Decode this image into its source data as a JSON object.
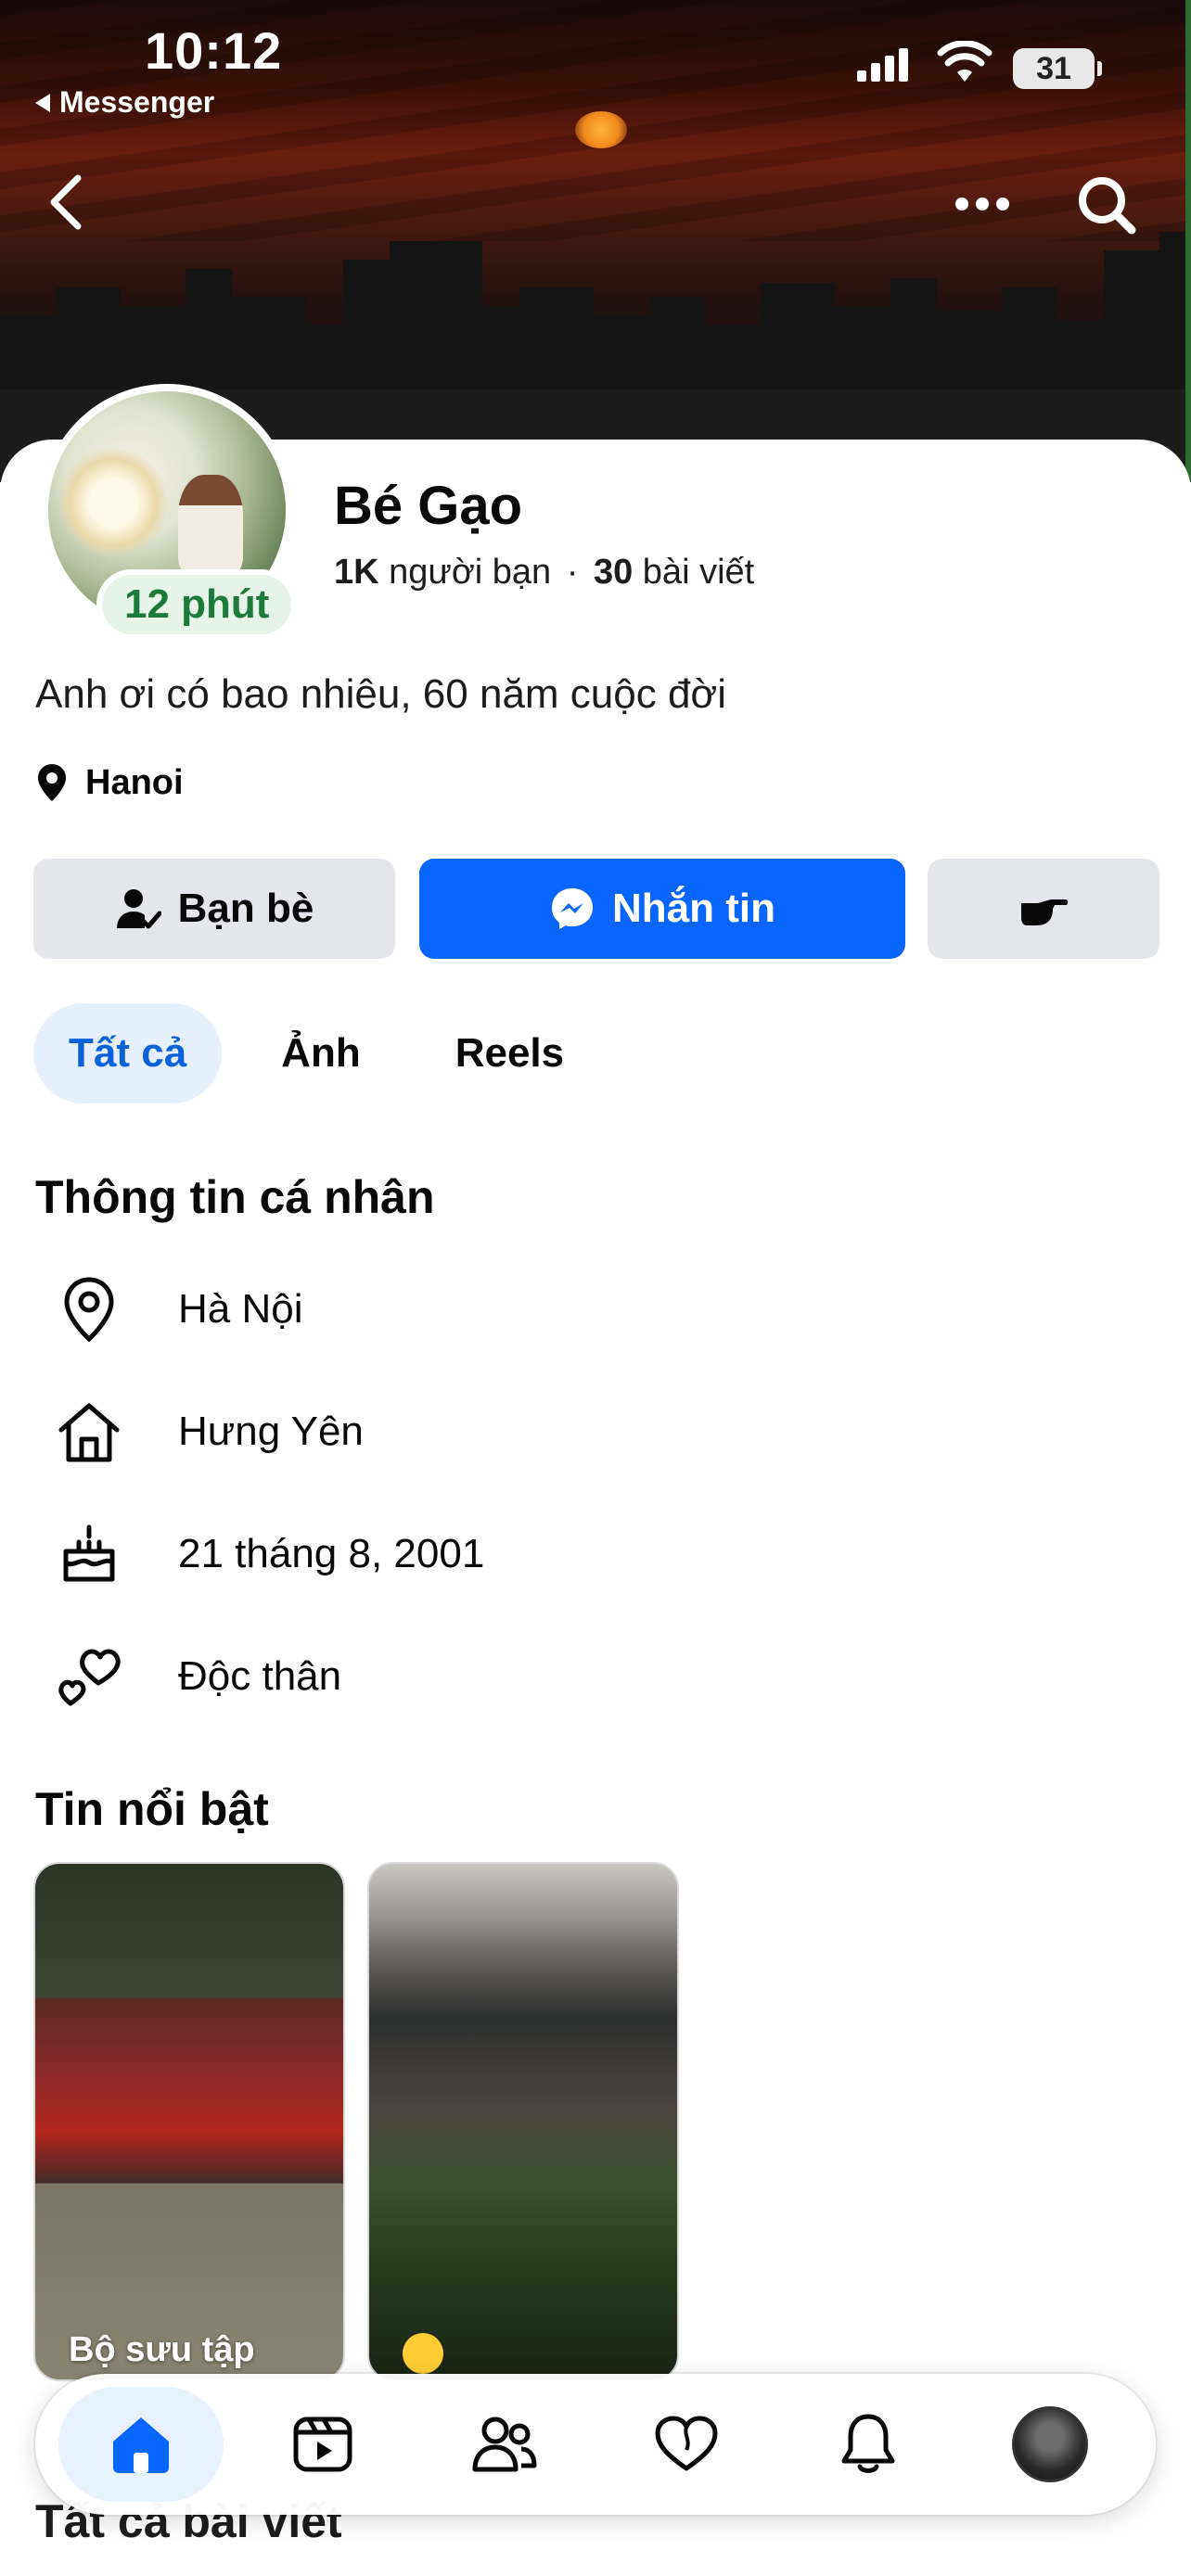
{
  "status_bar": {
    "time": "10:12",
    "back_app": "Messenger",
    "battery": "31"
  },
  "profile": {
    "name": "Bé Gạo",
    "active_badge": "12 phút",
    "friends_count": "1K",
    "friends_label": "người bạn",
    "separator": "·",
    "posts_count": "30",
    "posts_label": "bài viết",
    "bio": "Anh ơi có bao nhiêu, 60 năm cuộc đời",
    "location": "Hanoi"
  },
  "actions": {
    "friends": "Bạn bè",
    "message": "Nhắn tin"
  },
  "tabs": [
    {
      "label": "Tất cả",
      "active": true
    },
    {
      "label": "Ảnh",
      "active": false
    },
    {
      "label": "Reels",
      "active": false
    }
  ],
  "personal_info": {
    "title": "Thông tin cá nhân",
    "items": [
      {
        "icon": "location-pin-icon",
        "text": "Hà Nội"
      },
      {
        "icon": "home-icon",
        "text": "Hưng Yên"
      },
      {
        "icon": "birthday-cake-icon",
        "text": "21 tháng 8, 2001"
      },
      {
        "icon": "hearts-icon",
        "text": "Độc thân"
      }
    ]
  },
  "highlights": {
    "title": "Tin nổi bật",
    "items": [
      {
        "label": "Bộ sưu tập"
      },
      {
        "label": ""
      }
    ]
  },
  "all_posts_title": "Tất cả bài viết",
  "bottom_nav": [
    {
      "icon": "home-icon",
      "active": true
    },
    {
      "icon": "video-icon",
      "active": false
    },
    {
      "icon": "friends-icon",
      "active": false
    },
    {
      "icon": "dating-heart-icon",
      "active": false
    },
    {
      "icon": "bell-icon",
      "active": false
    },
    {
      "icon": "profile-avatar-icon",
      "active": false
    }
  ],
  "colors": {
    "primary_blue": "#0866ff",
    "active_tab_bg": "#e7f0fd",
    "active_tab_text": "#0a62d8",
    "online_green": "#1d7a3a"
  }
}
